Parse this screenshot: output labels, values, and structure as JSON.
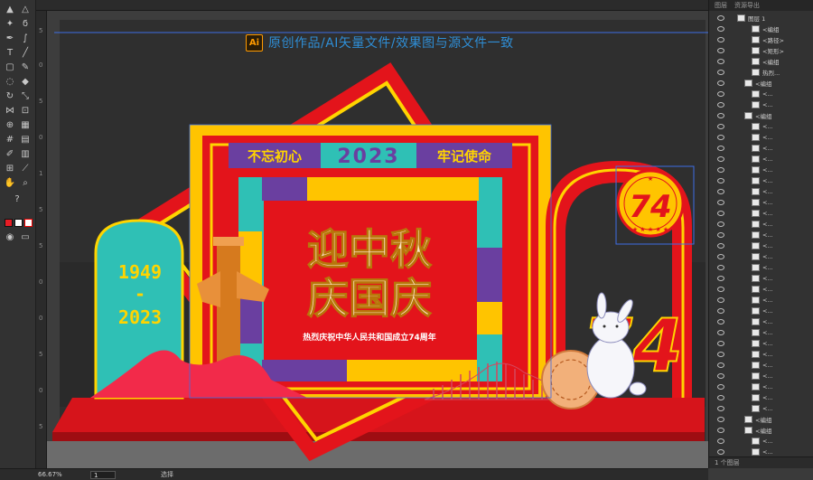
{
  "banner": {
    "logo": "Ai",
    "text": "原创作品/AI矢量文件/效果图与源文件一致"
  },
  "design": {
    "top_left_banner": "不忘初心",
    "year_banner": "2023",
    "top_right_banner": "牢记使命",
    "headline_line1": "迎中秋",
    "headline_line2": "庆国庆",
    "subtitle": "热烈庆祝中华人民共和国成立74周年",
    "left_year_start": "1949",
    "left_dash": "-",
    "left_year_end": "2023",
    "badge_number": "74"
  },
  "rulers": {
    "left": [
      "5",
      "0",
      "5",
      "0",
      "1",
      "5",
      "5",
      "0",
      "0",
      "5",
      "0",
      "5"
    ]
  },
  "layers_panel": {
    "tab_labels": [
      "图层",
      "资源导出"
    ],
    "rows": [
      {
        "name": "图层 1",
        "depth": 0
      },
      {
        "name": "<编组",
        "depth": 2
      },
      {
        "name": "<路径>",
        "depth": 2
      },
      {
        "name": "<矩形>",
        "depth": 2
      },
      {
        "name": "<编组",
        "depth": 2
      },
      {
        "name": "热烈...",
        "depth": 2
      },
      {
        "name": "<编组",
        "depth": 1
      },
      {
        "name": "<...",
        "depth": 2
      },
      {
        "name": "<...",
        "depth": 2
      },
      {
        "name": "<编组",
        "depth": 1
      },
      {
        "name": "<...",
        "depth": 2
      },
      {
        "name": "<...",
        "depth": 2
      },
      {
        "name": "<...",
        "depth": 2
      },
      {
        "name": "<...",
        "depth": 2
      },
      {
        "name": "<...",
        "depth": 2
      },
      {
        "name": "<...",
        "depth": 2
      },
      {
        "name": "<...",
        "depth": 2
      },
      {
        "name": "<...",
        "depth": 2
      },
      {
        "name": "<...",
        "depth": 2
      },
      {
        "name": "<...",
        "depth": 2
      },
      {
        "name": "<...",
        "depth": 2
      },
      {
        "name": "<...",
        "depth": 2
      },
      {
        "name": "<...",
        "depth": 2
      },
      {
        "name": "<...",
        "depth": 2
      },
      {
        "name": "<...",
        "depth": 2
      },
      {
        "name": "<...",
        "depth": 2
      },
      {
        "name": "<...",
        "depth": 2
      },
      {
        "name": "<...",
        "depth": 2
      },
      {
        "name": "<...",
        "depth": 2
      },
      {
        "name": "<...",
        "depth": 2
      },
      {
        "name": "<...",
        "depth": 2
      },
      {
        "name": "<...",
        "depth": 2
      },
      {
        "name": "<...",
        "depth": 2
      },
      {
        "name": "<...",
        "depth": 2
      },
      {
        "name": "<...",
        "depth": 2
      },
      {
        "name": "<...",
        "depth": 2
      },
      {
        "name": "<...",
        "depth": 2
      },
      {
        "name": "<编组",
        "depth": 1
      },
      {
        "name": "<编组",
        "depth": 1
      },
      {
        "name": "<...",
        "depth": 2
      },
      {
        "name": "<...",
        "depth": 2
      }
    ],
    "footer": "1 个图层"
  },
  "status": {
    "zoom": "66.67%",
    "page": "1",
    "tool": "选择"
  }
}
